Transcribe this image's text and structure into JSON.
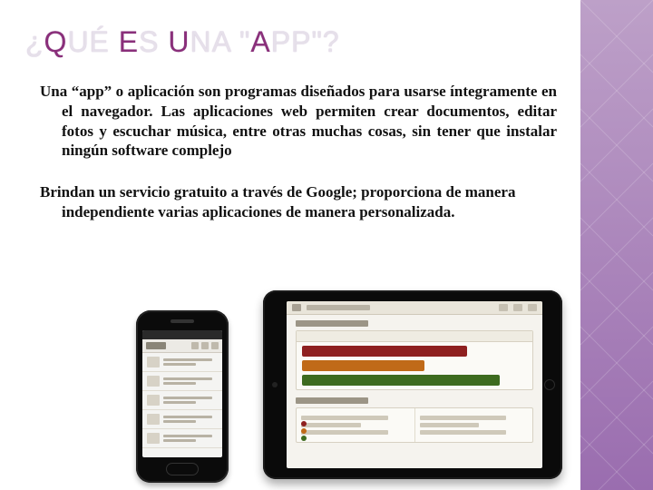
{
  "title": {
    "pre": "¿",
    "word1": "Q",
    "rest1": "UÉ ",
    "word2": "E",
    "rest2": "S ",
    "word3": "U",
    "rest3": "NA \"",
    "word4": "A",
    "rest4": "PP\"?"
  },
  "paragraphs": {
    "p1": "Una “app” o aplicación son programas diseñados para usarse íntegramente en el navegador. Las aplicaciones web permiten crear documentos, editar fotos y escuchar música, entre otras muchas cosas, sin tener que instalar ningún software complejo",
    "p2": "Brindan un servicio gratuito a través de Google; proporciona de manera independiente  varias aplicaciones de manera personalizada."
  }
}
